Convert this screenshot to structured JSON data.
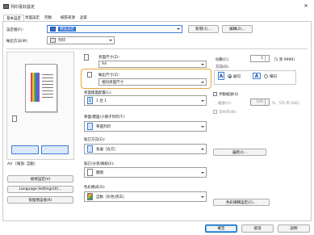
{
  "window": {
    "title": "列印喜好設定"
  },
  "tabs": [
    {
      "label": "基本設定",
      "active": true
    },
    {
      "label": "頁面設定",
      "active": false
    },
    {
      "label": "完稿",
      "active": false
    },
    {
      "label": "紙張來源",
      "active": false
    },
    {
      "label": "品質",
      "active": false
    }
  ],
  "profile": {
    "label": "設定檔(F):",
    "value": "預設設定",
    "add_button": "新增(1)...",
    "edit_button": "編輯(2)..."
  },
  "output_method": {
    "label": "輸出方法(M):",
    "value": "列印"
  },
  "preview": {
    "caption": "A4 ［縮放: 自動］"
  },
  "left_buttons": {
    "view_settings": "檢視設定(V)",
    "language_settings": "Language Settings(X)...",
    "restore_defaults": "恢復預設值(R)"
  },
  "page_size": {
    "label": "頁面尺寸(Z):",
    "value": "A4"
  },
  "output_size": {
    "label": "輸出尺寸(Z):",
    "value": "相同頁面尺寸"
  },
  "copies": {
    "label": "份數(C):",
    "value": "1",
    "range": "［1 到 9999］"
  },
  "orientation": {
    "label": "方向(O)",
    "portrait": "縱向",
    "landscape": "橫向",
    "selected": "portrait"
  },
  "page_layout": {
    "label": "頁面版面配置(L):",
    "value": "1 合 1"
  },
  "manual_scaling": {
    "label": "手動縮放(S)",
    "scaling_label": "縮放(C):",
    "value": "100",
    "range": "% ［25 到 200］",
    "watermark_label": "浮水印(W)"
  },
  "print_style": {
    "label": "單面/雙面/小冊子列印(T):",
    "value": "單面列印"
  },
  "binding": {
    "label": "裝訂方向(G):",
    "value": "長邊［左方］",
    "margin_button": "邊距(I)..."
  },
  "finishing": {
    "label": "裝訂/分頁/群組(E):",
    "value": "關閉"
  },
  "color_mode": {
    "label": "色彩模式(O):",
    "value": "自動［彩色/黑白］",
    "color_settings_button": "色彩細節設定(C)..."
  },
  "footer": {
    "ok": "確定",
    "cancel": "取消",
    "help": "說明"
  },
  "colors": {
    "accent": "#0067c0",
    "highlight_border": "#e8a33a"
  }
}
